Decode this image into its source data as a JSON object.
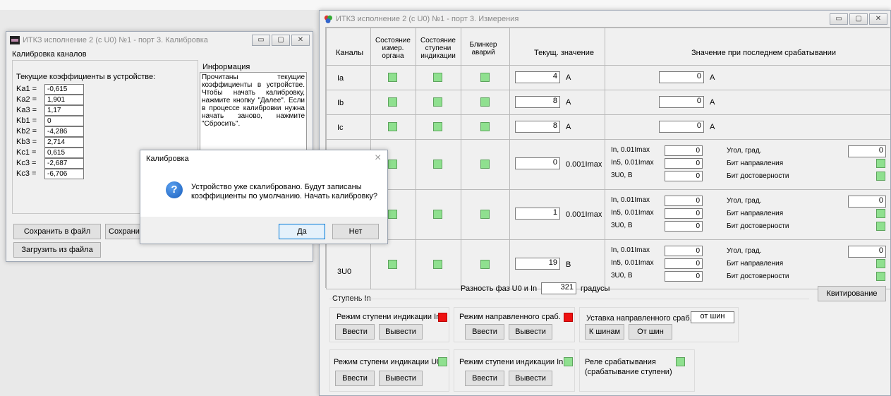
{
  "calib_window": {
    "title": "ИТКЗ исполнение 2 (с U0) №1 - порт 3. Калибровка",
    "section": "Калибровка каналов",
    "coef_label": "Текущие коэффициенты в устройстве:",
    "coefs": [
      {
        "name": "Ka1 =",
        "value": "-0,615"
      },
      {
        "name": "Ka2 =",
        "value": "1,901"
      },
      {
        "name": "Ka3 =",
        "value": "1,17"
      },
      {
        "name": "Kb1 =",
        "value": "0"
      },
      {
        "name": "Kb2 =",
        "value": "-4,286"
      },
      {
        "name": "Kb3 =",
        "value": "2,714"
      },
      {
        "name": "Kc1 =",
        "value": "0,615"
      },
      {
        "name": "Kc3 =",
        "value": "-2,687"
      },
      {
        "name": "Kc3 =",
        "value": "-6,706"
      }
    ],
    "info_title": "Информация",
    "info_text": "Прочитаны текущие коэффициенты в устройстве. Чтобы начать калибровку, нажмите кнопку \"Далее\". Если в процессе калибровки нужна начать заново, нажмите \"Сбросить\".",
    "btn_save_file": "Сохранить в файл",
    "btn_save_dev": "Сохранить",
    "btn_load_file": "Загрузить из файла"
  },
  "meas_window": {
    "title": "ИТКЗ исполнение 2 (с U0) №1 - порт 3. Измерения",
    "headers": {
      "channels": "Каналы",
      "state_meas": "Состояние измер. органа",
      "state_stage": "Состояние ступени индикации",
      "blinker": "Блинкер аварий",
      "current": "Текущ. значение",
      "last": "Значение при последнем срабатывании"
    },
    "rows_simple": [
      {
        "name": "Ia",
        "value": "4",
        "unit": "А",
        "last": "0",
        "last_unit": "А"
      },
      {
        "name": "Ib",
        "value": "8",
        "unit": "А",
        "last": "0",
        "last_unit": "А"
      },
      {
        "name": "Ic",
        "value": "8",
        "unit": "А",
        "last": "0",
        "last_unit": "А"
      }
    ],
    "rows_complex": [
      {
        "name": "",
        "value": "0",
        "unit": "0.001Imax",
        "p1": "In, 0.01Imax",
        "v1": "0",
        "p2": "In5, 0.01Imax",
        "v2": "0",
        "p3": "3U0, В",
        "v3": "0",
        "angle_label": "Угол, град.",
        "angle": "0",
        "dir_label": "Бит направления",
        "valid_label": "Бит достоверности"
      },
      {
        "name": "",
        "value": "1",
        "unit": "0.001Imax",
        "p1": "In, 0.01Imax",
        "v1": "0",
        "p2": "In5, 0.01Imax",
        "v2": "0",
        "p3": "3U0, В",
        "v3": "0",
        "angle_label": "Угол, град.",
        "angle": "0",
        "dir_label": "Бит направления",
        "valid_label": "Бит достоверности"
      },
      {
        "name": "3U0",
        "value": "19",
        "unit": "В",
        "p1": "In, 0.01Imax",
        "v1": "0",
        "p2": "In5, 0.01Imax",
        "v2": "0",
        "p3": "3U0, В",
        "v3": "0",
        "angle_label": "Угол, град.",
        "angle": "0",
        "dir_label": "Бит направления",
        "valid_label": "Бит достоверности"
      }
    ],
    "phase_label": "Разность фаз U0 и In",
    "phase_value": "321",
    "phase_unit": "градусы",
    "ack_button": "Квитирование",
    "stage_group": "Ступень In",
    "mode_in_label": "Режим ступени индикации In",
    "mode_dir_label": "Режим направленного сраб.",
    "setpoint_label": "Уставка направленного сраб.",
    "setpoint_value": "от шин",
    "btn_enter": "Ввести",
    "btn_exit": "Вывести",
    "btn_to_bus": "К шинам",
    "btn_from_bus": "От шин",
    "mode_u0_label": "Режим ступени индикации U0",
    "mode_in5_label": "Режим ступени индикации In5",
    "relay_label1": "Реле срабатывания",
    "relay_label2": "(срабатывание ступени)"
  },
  "dialog": {
    "title": "Калибровка",
    "message1": "Устройство уже скалибровано. Будут записаны",
    "message2": "коэффициенты по умолчанию. Начать калибровку?",
    "btn_yes": "Да",
    "btn_no": "Нет",
    "close": "×",
    "q": "?"
  },
  "ctrl_glyphs": {
    "min": "▭",
    "max": "▢",
    "close": "✕"
  }
}
